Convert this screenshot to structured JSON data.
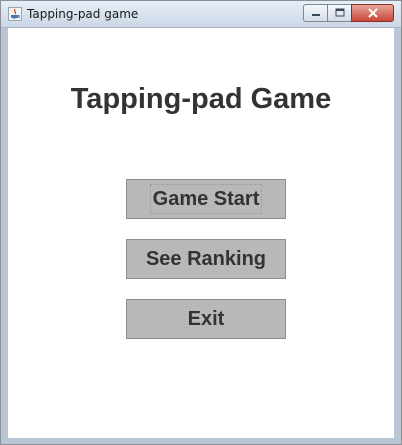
{
  "window": {
    "title": "Tapping-pad game"
  },
  "main": {
    "heading": "Tapping-pad Game",
    "buttons": {
      "start": "Game Start",
      "ranking": "See Ranking",
      "exit": "Exit"
    }
  },
  "icons": {
    "app": "java-cup-icon",
    "minimize": "minimize-icon",
    "maximize": "maximize-icon",
    "close": "close-icon"
  },
  "colors": {
    "button_bg": "#b8b8b8",
    "text": "#333333",
    "close_button": "#c9473a"
  }
}
